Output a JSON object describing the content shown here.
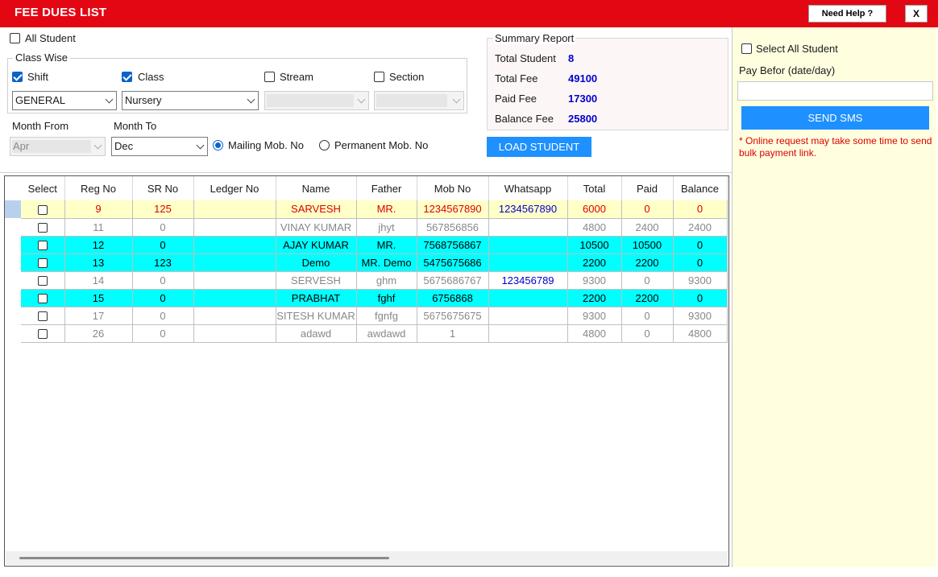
{
  "window": {
    "title": "FEE DUES LIST",
    "help_label": "Need Help ?",
    "close_label": "X",
    "accent_color": "#e30613"
  },
  "filters": {
    "all_student_label": "All Student",
    "class_wise_legend": "Class Wise",
    "shift": {
      "label": "Shift",
      "checked": true,
      "value": "GENERAL"
    },
    "class": {
      "label": "Class",
      "checked": true,
      "value": "Nursery"
    },
    "stream": {
      "label": "Stream",
      "checked": false,
      "value": ""
    },
    "section": {
      "label": "Section",
      "checked": false,
      "value": ""
    },
    "month_from": {
      "label": "Month From",
      "value": "Apr"
    },
    "month_to": {
      "label": "Month To",
      "value": "Dec"
    },
    "mailing_mob_label": "Mailing Mob. No",
    "permanent_mob_label": "Permanent Mob. No",
    "selected_mobile": "mailing"
  },
  "summary": {
    "legend": "Summary Report",
    "total_student_label": "Total Student",
    "total_student": "8",
    "total_fee_label": "Total Fee",
    "total_fee": "49100",
    "paid_fee_label": "Paid Fee",
    "paid_fee": "17300",
    "balance_fee_label": "Balance Fee",
    "balance_fee": "25800"
  },
  "load_student_label": "LOAD STUDENT",
  "table": {
    "columns": [
      "Select",
      "Reg No",
      "SR No",
      "Ledger No",
      "Name",
      "Father",
      "Mob No",
      "Whatsapp",
      "Total",
      "Paid",
      "Balance"
    ],
    "rows": [
      {
        "status": "current",
        "reg_no": "9",
        "sr_no": "125",
        "ledger_no": "",
        "name": "SARVESH",
        "father": "MR.",
        "mob_no": "1234567890",
        "whatsapp": "1234567890",
        "total": "6000",
        "paid": "0",
        "balance": "0"
      },
      {
        "status": "due",
        "reg_no": "11",
        "sr_no": "0",
        "ledger_no": "",
        "name": "VINAY KUMAR",
        "father": "jhyt",
        "mob_no": "567856856",
        "whatsapp": "",
        "total": "4800",
        "paid": "2400",
        "balance": "2400"
      },
      {
        "status": "paid",
        "reg_no": "12",
        "sr_no": "0",
        "ledger_no": "",
        "name": "AJAY KUMAR",
        "father": "MR.",
        "mob_no": "7568756867",
        "whatsapp": "",
        "total": "10500",
        "paid": "10500",
        "balance": "0"
      },
      {
        "status": "paid",
        "reg_no": "13",
        "sr_no": "123",
        "ledger_no": "",
        "name": "Demo",
        "father": "MR. Demo",
        "mob_no": "5475675686",
        "whatsapp": "",
        "total": "2200",
        "paid": "2200",
        "balance": "0"
      },
      {
        "status": "due",
        "reg_no": "14",
        "sr_no": "0",
        "ledger_no": "",
        "name": "SERVESH",
        "father": "ghm",
        "mob_no": "5675686767",
        "whatsapp": "123456789",
        "total": "9300",
        "paid": "0",
        "balance": "9300"
      },
      {
        "status": "paid",
        "reg_no": "15",
        "sr_no": "0",
        "ledger_no": "",
        "name": "PRABHAT",
        "father": "fghf",
        "mob_no": "6756868",
        "whatsapp": "",
        "total": "2200",
        "paid": "2200",
        "balance": "0"
      },
      {
        "status": "due",
        "reg_no": "17",
        "sr_no": "0",
        "ledger_no": "",
        "name": "SITESH KUMAR",
        "father": "fgnfg",
        "mob_no": "5675675675",
        "whatsapp": "",
        "total": "9300",
        "paid": "0",
        "balance": "9300"
      },
      {
        "status": "due",
        "reg_no": "26",
        "sr_no": "0",
        "ledger_no": "",
        "name": "adawd",
        "father": "awdawd",
        "mob_no": "1",
        "whatsapp": "",
        "total": "4800",
        "paid": "0",
        "balance": "4800"
      }
    ]
  },
  "sms_panel": {
    "select_all_label": "Select All Student",
    "pay_before_label": "Pay Befor (date/day)",
    "pay_before_value": "",
    "send_sms_label": "SEND SMS",
    "note": "* Online request may take some time to send bulk payment link."
  }
}
